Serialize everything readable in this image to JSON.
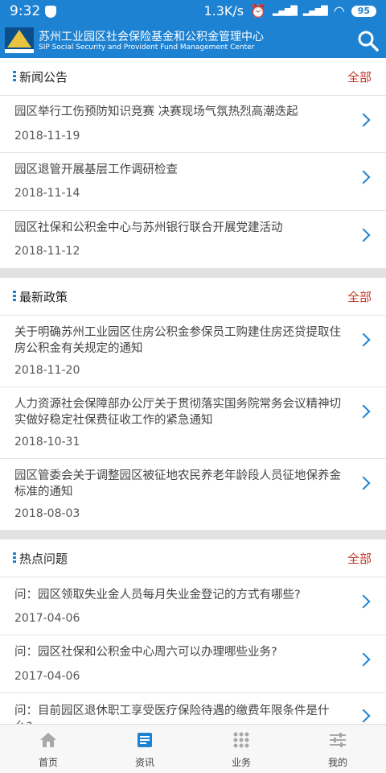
{
  "status": {
    "time": "9:32",
    "speed": "1.3K/s",
    "battery": "95"
  },
  "header": {
    "title_cn": "苏州工业园区社会保险基金和公积金管理中心",
    "title_en": "SIP Social Security and Provident Fund Management Center"
  },
  "sections": [
    {
      "name": "新闻公告",
      "more": "全部",
      "items": [
        {
          "title": "园区举行工伤预防知识竞赛 决赛现场气氛热烈高潮迭起",
          "date": "2018-11-19"
        },
        {
          "title": "园区退管开展基层工作调研检查",
          "date": "2018-11-14"
        },
        {
          "title": "园区社保和公积金中心与苏州银行联合开展党建活动",
          "date": "2018-11-12"
        }
      ]
    },
    {
      "name": "最新政策",
      "more": "全部",
      "items": [
        {
          "title": "关于明确苏州工业园区住房公积金参保员工购建住房还贷提取住房公积金有关规定的通知",
          "date": "2018-11-20"
        },
        {
          "title": "人力资源社会保障部办公厅关于贯彻落实国务院常务会议精神切实做好稳定社保费征收工作的紧急通知",
          "date": "2018-10-31"
        },
        {
          "title": "园区管委会关于调整园区被征地农民养老年龄段人员征地保养金标准的通知",
          "date": "2018-08-03"
        }
      ]
    },
    {
      "name": "热点问题",
      "more": "全部",
      "items": [
        {
          "title": "问：园区领取失业金人员每月失业金登记的方式有哪些?",
          "date": "2017-04-06"
        },
        {
          "title": "问：园区社保和公积金中心周六可以办理哪些业务?",
          "date": "2017-04-06"
        },
        {
          "title": "问：目前园区退休职工享受医疗保险待遇的缴费年限条件是什么?",
          "date": ""
        }
      ]
    }
  ],
  "tabs": [
    {
      "label": "首页",
      "icon": "home-icon"
    },
    {
      "label": "资讯",
      "icon": "news-icon"
    },
    {
      "label": "业务",
      "icon": "grid-icon"
    },
    {
      "label": "我的",
      "icon": "sliders-icon"
    }
  ],
  "colors": {
    "primary": "#1e82d2",
    "more_link": "#c0392b",
    "active_tab": "#1e82d2"
  }
}
